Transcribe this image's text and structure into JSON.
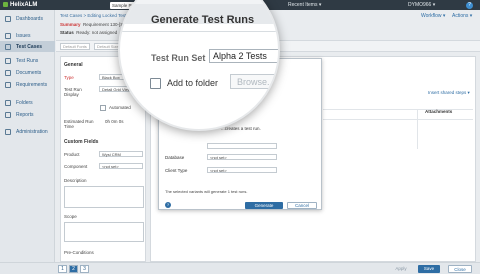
{
  "app": {
    "brand": "HelixALM",
    "project": "Sample Project",
    "recent_items": "Recent Items ▾",
    "user": "DYMO966 ▾",
    "help": "?"
  },
  "sidebar": {
    "items": [
      {
        "label": "Dashboards"
      },
      {
        "label": "Issues"
      },
      {
        "label": "Test Cases"
      },
      {
        "label": "Test Runs"
      },
      {
        "label": "Documents"
      },
      {
        "label": "Requirements"
      },
      {
        "label": "Folders"
      },
      {
        "label": "Reports"
      },
      {
        "label": "Administration"
      }
    ],
    "collapse": "◂◂"
  },
  "header": {
    "breadcrumb": "Test Cases > Editing Locked Test Case 51",
    "workflow": "Workflow ▾",
    "actions": "Actions ▾",
    "summary_label": "Summary",
    "summary_value": "Requirement 130-[Sys-CRM 2.0 needs a record ... which other's enables",
    "status_label": "Status",
    "status_value": "Ready: not assigned"
  },
  "toolbar": {
    "sel1": "Default Fonts",
    "sel2": "Default Size"
  },
  "form": {
    "general": "General",
    "type_label": "Type",
    "type_value": "Black Box",
    "display_label": "Test Run Display",
    "display_value": "Detail Grid View",
    "automated_label": "Automated",
    "est_time_label": "Estimated Run Time",
    "est_time_value": "0h 0m 0s",
    "custom_fields": "Custom Fields",
    "product_label": "Product",
    "product_value": "Wysi CRM",
    "component_label": "Component",
    "component_value": "<not set>",
    "description_label": "Description",
    "scope_label": "Scope",
    "preconditions_label": "Pre-Conditions"
  },
  "right": {
    "insert": "Insert shared steps ▾",
    "attachments": "Attachments"
  },
  "dialog": {
    "title": "Generate Test Runs",
    "test_run_set_label": "Test Run Set",
    "test_run_set_value": "Alpha 2 Tests",
    "add_to_folder_label": "Add to folder",
    "browse_label": "Browse...",
    "create_note": "...creates a test run.",
    "database_label": "Database",
    "database_value": "<not set>",
    "client_type_label": "Client Type",
    "client_type_value": "<not set>",
    "footer_note": "The selected variants will generate 1 test runs.",
    "help": "?",
    "generate": "Generate",
    "cancel": "Cancel"
  },
  "bottom": {
    "pages": [
      "1",
      "2",
      "3"
    ],
    "apply": "Apply",
    "save": "Save",
    "close": "Close"
  }
}
